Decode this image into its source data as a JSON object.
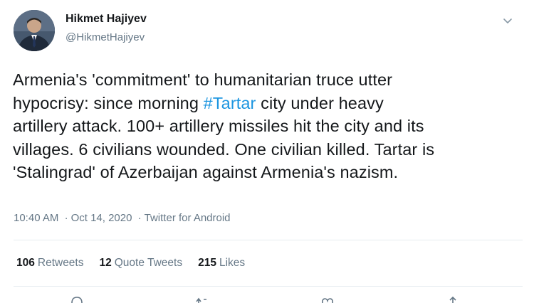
{
  "tweet": {
    "author_name": "Hikmet Hajiyev",
    "author_handle": "@HikmetHajiyev",
    "text_lines": [
      {
        "before": "Armenia's 'commitment' to humanitarian truce utter",
        "hashtag": "",
        "after": ""
      },
      {
        "before": "hypocrisy: since morning ",
        "hashtag": "#Tartar",
        "after": " city under heavy"
      },
      {
        "before": "artillery attack. 100+ artillery missiles hit the city and its",
        "hashtag": "",
        "after": ""
      },
      {
        "before": "villages. 6 civilians wounded. One civilian killed. Tartar is",
        "hashtag": "",
        "after": ""
      },
      {
        "before": "'Stalingrad' of Azerbaijan against Armenia's nazism.",
        "hashtag": "",
        "after": ""
      }
    ],
    "time": "10:40 AM",
    "date": "Oct 14, 2020",
    "separator": "·",
    "source": "Twitter for Android",
    "stats": {
      "retweets_count": "106",
      "retweets_label": "Retweets",
      "quote_count": "12",
      "quote_label": "Quote Tweets",
      "likes_count": "215",
      "likes_label": "Likes"
    }
  },
  "colors": {
    "link": "#1b95e0",
    "secondary_text": "#657786",
    "primary_text": "#14171a",
    "divider": "#e6ecf0"
  },
  "icons": {
    "menu": "chevron-down-icon",
    "reply": "reply-icon",
    "retweet": "retweet-icon",
    "like": "heart-icon",
    "share": "share-icon"
  }
}
